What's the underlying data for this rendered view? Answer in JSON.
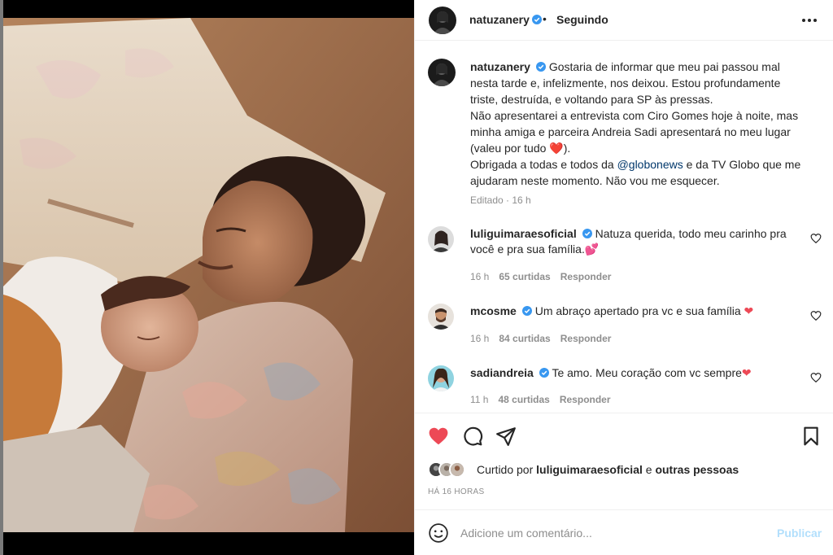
{
  "post": {
    "author": "natuzanery",
    "follow_state": "Seguindo",
    "dot": "•",
    "caption_parts": [
      "Gostaria de informar que meu pai passou mal nesta tarde e, infelizmente, nos deixou. Estou profundamente triste, destruída, e voltando para SP às pressas.",
      "Não apresentarei a entrevista com Ciro Gomes hoje à noite, mas minha amiga e parceira Andreia Sadi apresentará no meu lugar (valeu por tudo",
      ").",
      "Obrigada a todas e todos da",
      "@globonews",
      "e da TV Globo que me ajudaram neste momento. Não vou me esquecer."
    ],
    "caption_meta": "Editado · 16 h"
  },
  "comments": [
    {
      "user": "luliguimaraesoficial",
      "text": "Natuza querida, todo meu carinho pra você e pra sua família.",
      "emoji": "💕",
      "time": "16 h",
      "likes": "65 curtidas",
      "reply": "Responder"
    },
    {
      "user": "mcosme",
      "text": "Um abraço apertado pra vc e sua família",
      "emoji": "❤",
      "time": "16 h",
      "likes": "84 curtidas",
      "reply": "Responder"
    },
    {
      "user": "sadiandreia",
      "text": "Te amo. Meu coração com vc sempre",
      "emoji": "❤",
      "time": "11 h",
      "likes": "48 curtidas",
      "reply": "Responder"
    }
  ],
  "likes": {
    "prefix": "Curtido por",
    "user": "luliguimaraesoficial",
    "connector": "e",
    "suffix": "outras pessoas"
  },
  "timestamp": "HÁ 16 HORAS",
  "add_comment": {
    "placeholder": "Adicione um comentário...",
    "publish_label": "Publicar"
  },
  "icons": {
    "verified": "verified-badge-icon",
    "more": "more-options-icon",
    "like": "heart-filled-icon",
    "comment": "comment-icon",
    "share": "share-icon",
    "save": "bookmark-icon",
    "emoji": "emoji-icon"
  },
  "colors": {
    "heart": "#ed4956",
    "verified": "#3897f0",
    "link": "#00376b",
    "muted": "#8e8e8e",
    "publish": "#b2dffc"
  }
}
